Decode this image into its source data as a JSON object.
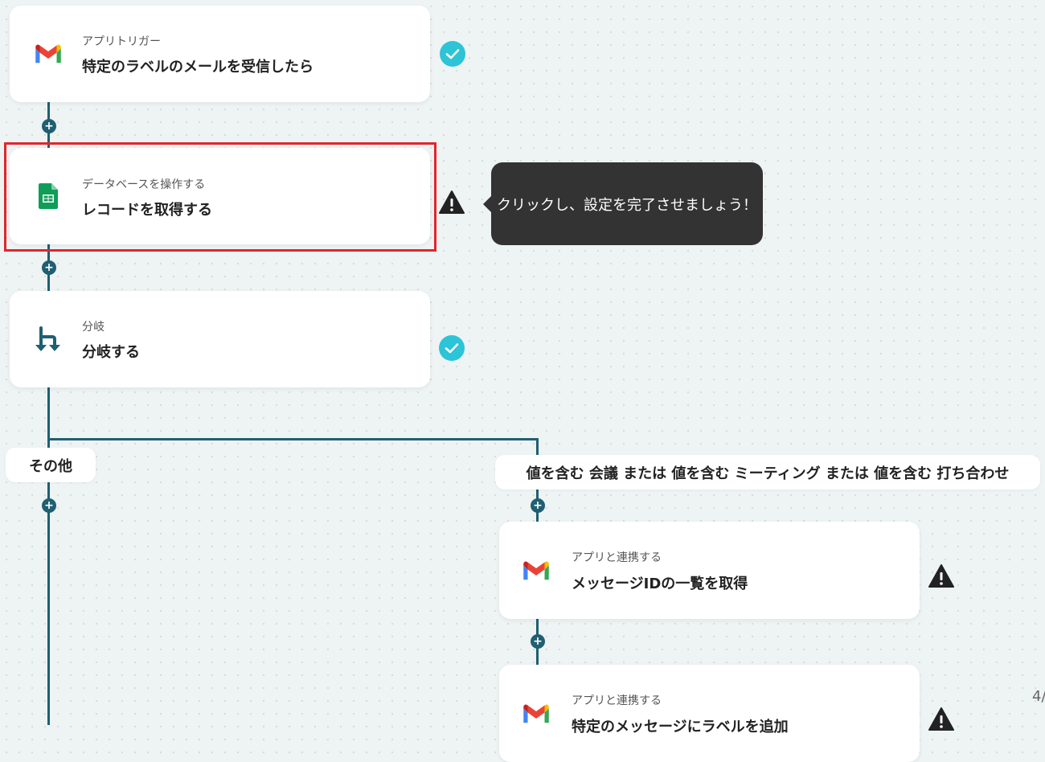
{
  "steps": [
    {
      "category": "アプリトリガー",
      "title": "特定のラベルのメールを受信したら",
      "app_icon": "gmail-icon",
      "status": "check"
    },
    {
      "category": "データベースを操作する",
      "title": "レコードを取得する",
      "app_icon": "google-sheets-icon",
      "status": "warning"
    },
    {
      "category": "分岐",
      "title": "分岐する",
      "app_icon": "branch-icon",
      "status": "check"
    }
  ],
  "tooltip": {
    "text": "クリックし、設定を完了させましょう！"
  },
  "branches": {
    "other_label": "その他",
    "condition_label": "値を含む 会議 または 値を含む ミーティング または 値を含む 打ち合わせ"
  },
  "branch_steps": [
    {
      "category": "アプリと連携する",
      "title": "メッセージIDの一覧を取得",
      "app_icon": "gmail-icon",
      "status": "warning"
    },
    {
      "category": "アプリと連携する",
      "title": "特定のメッセージにラベルを追加",
      "app_icon": "gmail-icon",
      "status": "warning"
    }
  ],
  "plus_symbol": "+",
  "page_indicator": "4/",
  "colors": {
    "connector": "#1f5f72",
    "check": "#2cc4d6",
    "highlight": "#e0262b",
    "tooltip_bg": "#333333"
  }
}
